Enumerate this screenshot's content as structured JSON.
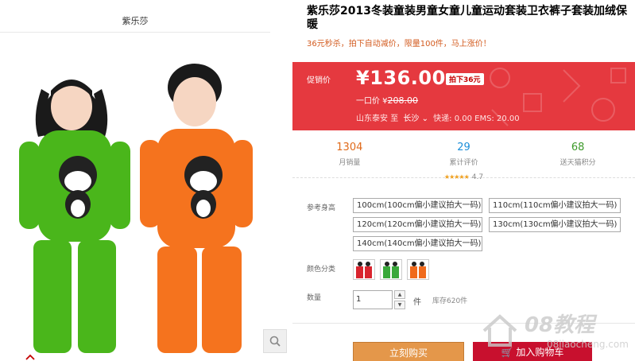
{
  "store": {
    "name": "紫乐莎"
  },
  "product": {
    "title": "紫乐莎2013冬装童装男童女童儿童运动套装卫衣裤子套装加绒保暖",
    "subtitle": "36元秒杀，拍下自动减价，限量100件，马上涨价！"
  },
  "price": {
    "promo_label": "促销价",
    "current": "¥136.00",
    "discount_tag": "拍下36元",
    "original_label": "一口价 ¥",
    "original_value": "208.00",
    "ship_from": "山东泰安",
    "ship_to_label": "至",
    "ship_to_city": "长沙",
    "ship_fees": "快递: 0.00 EMS: 20.00"
  },
  "stats": {
    "sales_value": "1304",
    "sales_label": "月销量",
    "reviews_value": "29",
    "reviews_label": "累计评价",
    "stars": "★★★★★",
    "rating": "4.7",
    "points_value": "68",
    "points_label": "送天猫积分"
  },
  "options": {
    "height_label": "参考身高",
    "sizes": [
      "100cm(100cm偏小建议拍大一码)",
      "110cm(110cm偏小建议拍大一码)",
      "120cm(120cm偏小建议拍大一码)",
      "130cm(130cm偏小建议拍大一码)",
      "140cm(140cm偏小建议拍大一码)"
    ],
    "color_label": "颜色分类",
    "colors": [
      "#d9242e",
      "#39a83a",
      "#f06a1c"
    ]
  },
  "quantity": {
    "label": "数量",
    "value": "1",
    "unit": "件",
    "stock": "库存620件"
  },
  "actions": {
    "buy_now": "立刻购买",
    "add_cart": "加入购物车"
  },
  "watermark": {
    "big": "08教程",
    "small": "08jiaocheng.com"
  },
  "colors": {
    "price_bg": "#e5393f",
    "accent": "#c40000",
    "buy_btn": "#e4974a",
    "cart_btn": "#c8102e"
  },
  "icons": [
    "zoom-icon",
    "chevron-down-icon",
    "cart-icon",
    "up-arrow-icon",
    "house-icon"
  ]
}
